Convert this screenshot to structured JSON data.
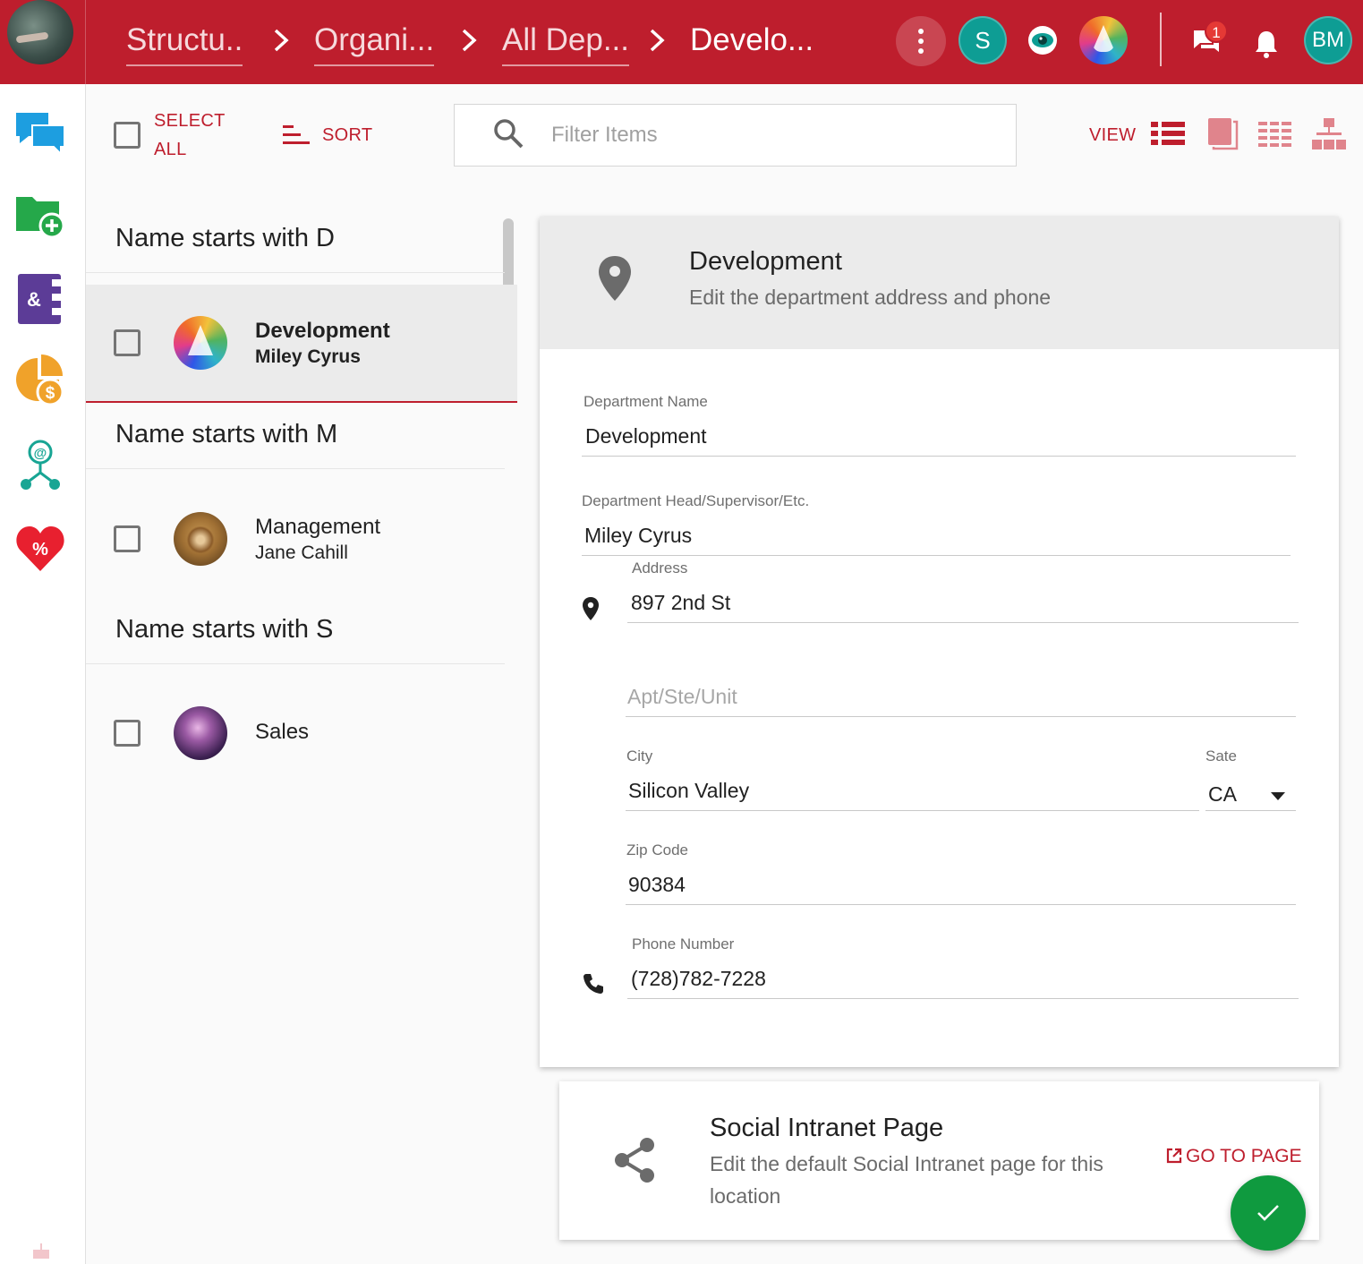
{
  "header": {
    "breadcrumbs": [
      {
        "label": "Structu.."
      },
      {
        "label": "Organi..."
      },
      {
        "label": "All Dep..."
      },
      {
        "label": "Develo..."
      }
    ],
    "user_avatar_initial": "S",
    "notification_count": "1",
    "profile_initials": "BM",
    "colors": {
      "primary": "#be1e2d",
      "teal": "#0e9d94"
    }
  },
  "left_nav": {
    "icons": [
      "chat-icon",
      "add-folder-icon",
      "contacts-book-icon",
      "budget-chart-icon",
      "network-icon",
      "discount-heart-icon"
    ]
  },
  "toolbar": {
    "select_all_line1": "SELECT",
    "select_all_line2": "ALL",
    "sort_label": "SORT",
    "filter_placeholder": "Filter Items",
    "view_label": "VIEW"
  },
  "list": {
    "groups": [
      {
        "heading": "Name starts with D",
        "items": [
          {
            "title": "Development",
            "subtitle": "Miley Cyrus",
            "selected": true
          }
        ]
      },
      {
        "heading": "Name starts with M",
        "items": [
          {
            "title": "Management",
            "subtitle": "Jane Cahill",
            "selected": false
          }
        ]
      },
      {
        "heading": "Name starts with S",
        "items": [
          {
            "title": "Sales",
            "subtitle": "",
            "selected": false
          }
        ]
      }
    ]
  },
  "detail": {
    "title": "Development",
    "subtitle": "Edit the department address and phone",
    "department_name_label": "Department Name",
    "department_name_value": "Development",
    "head_label": "Department Head/Supervisor/Etc.",
    "head_value": "Miley Cyrus",
    "address_label": "Address",
    "address_value": "897 2nd St",
    "apt_placeholder": "Apt/Ste/Unit",
    "city_label": "City",
    "city_value": "Silicon Valley",
    "state_label": "Sate",
    "state_value": "CA",
    "zip_label": "Zip Code",
    "zip_value": "90384",
    "phone_label": "Phone Number",
    "phone_value": "(728)782-7228"
  },
  "social": {
    "title": "Social Intranet Page",
    "subtitle": "Edit the default Social Intranet page for this location",
    "go_to_page": "GO TO PAGE"
  }
}
